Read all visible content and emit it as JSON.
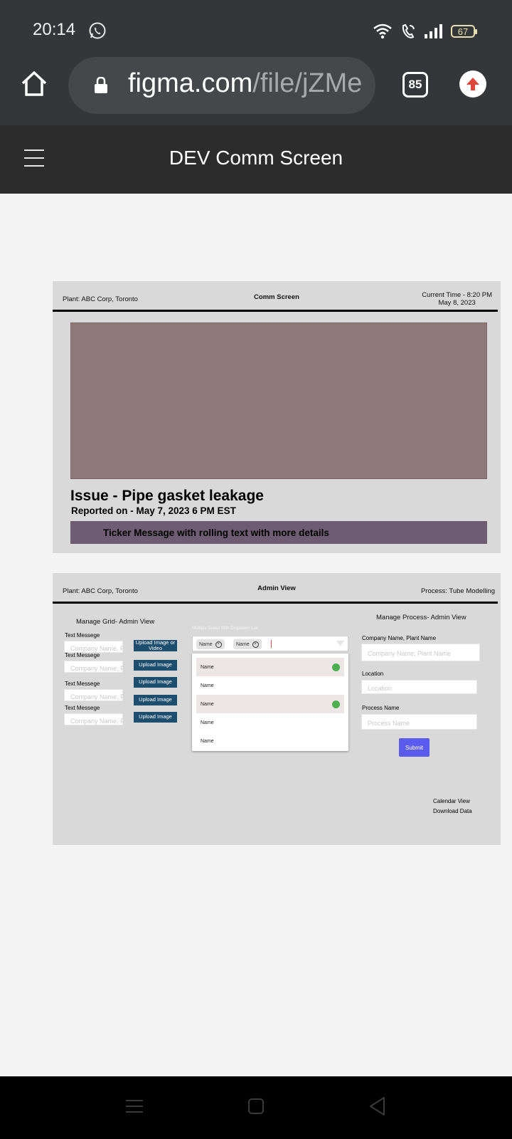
{
  "status_bar": {
    "time": "20:14",
    "battery": "67"
  },
  "browser": {
    "url_domain": "figma.com",
    "url_path": "/file/jZMe",
    "tab_count": "85"
  },
  "figma": {
    "file_title": "DEV Comm Screen"
  },
  "comm_screen": {
    "plant": "Plant: ABC Corp, Toronto",
    "title": "Comm Screen",
    "current_time": "Current Time - 8:20 PM",
    "date": "May 8, 2023",
    "issue": "Issue - Pipe gasket leakage",
    "reported": "Reported on - May 7, 2023 6 PM EST",
    "ticker": "Ticker Message with rolling text with more details"
  },
  "admin_view": {
    "plant": "Plant: ABC Corp, Toronto",
    "title": "Admin View",
    "process": "Process: Tube Modelling",
    "manage_grid": {
      "heading": "Manage Grid- Admin View",
      "rows": [
        {
          "label": "Text Messege",
          "placeholder": "Company Name, Pla",
          "button": "Upload Image or Video"
        },
        {
          "label": "Text Messege",
          "placeholder": "Company Name, Pla",
          "button": "Upload Image"
        },
        {
          "label": "Text Messege",
          "placeholder": "Company Name, Pla",
          "button": "Upload Image"
        },
        {
          "label": "Text Messege",
          "placeholder": "Company Name, Pla",
          "button": "Upload Image"
        }
      ],
      "extra_button": "Upload Image"
    },
    "multi_select": {
      "label": "Multiple Select With Dropdown List",
      "chips": [
        "Name",
        "Name"
      ],
      "options": [
        {
          "label": "Name",
          "selected": true
        },
        {
          "label": "Name",
          "selected": false
        },
        {
          "label": "Name",
          "selected": true
        },
        {
          "label": "Name",
          "selected": false
        },
        {
          "label": "Name",
          "selected": false
        }
      ]
    },
    "manage_process": {
      "heading": "Manage Process- Admin View",
      "company_label": "Company Name, Plant Name",
      "company_placeholder": "Company Name, Plant Name",
      "location_label": "Location",
      "location_placeholder": "Location",
      "process_label": "Process Name",
      "process_placeholder": "Process Name",
      "submit": "Submit"
    },
    "links": {
      "calendar": "Calendar View",
      "download": "Download Data"
    }
  },
  "colors": {
    "accent_submit": "#5b5bf0",
    "upload_button": "#1d4e6d",
    "ticker_bg": "#6e5d72",
    "media_box": "#8f7a7a"
  }
}
